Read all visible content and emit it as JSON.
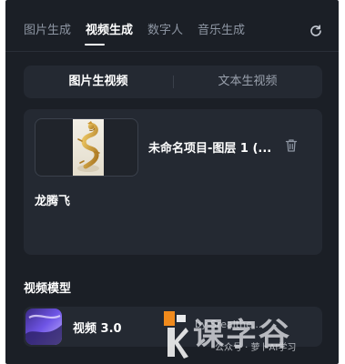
{
  "tabs": [
    {
      "label": "图片生成",
      "active": false
    },
    {
      "label": "视频生成",
      "active": true
    },
    {
      "label": "数字人",
      "active": false
    },
    {
      "label": "音乐生成",
      "active": false
    }
  ],
  "mode_switch": {
    "left_label": "图片生视频",
    "right_label": "文本生视频",
    "selected": "图片生视频"
  },
  "upload_item": {
    "title": "未命名项目-图层 1 (...",
    "prompt": "龙腾飞"
  },
  "model_section": {
    "label": "视频模型",
    "selected_model": "视频 3.0"
  },
  "watermark": {
    "line1": "by Srealthe...",
    "line2": "公众号 · 萝卜AI学习",
    "big": "课字谷"
  },
  "colors": {
    "background": "#1b1f26",
    "card": "#242932",
    "text_primary": "#ffffff",
    "text_secondary": "#8e96a3",
    "watermark_orange": "#f08a1c"
  },
  "icons": {
    "refresh": "refresh-icon",
    "delete": "trash-icon"
  }
}
